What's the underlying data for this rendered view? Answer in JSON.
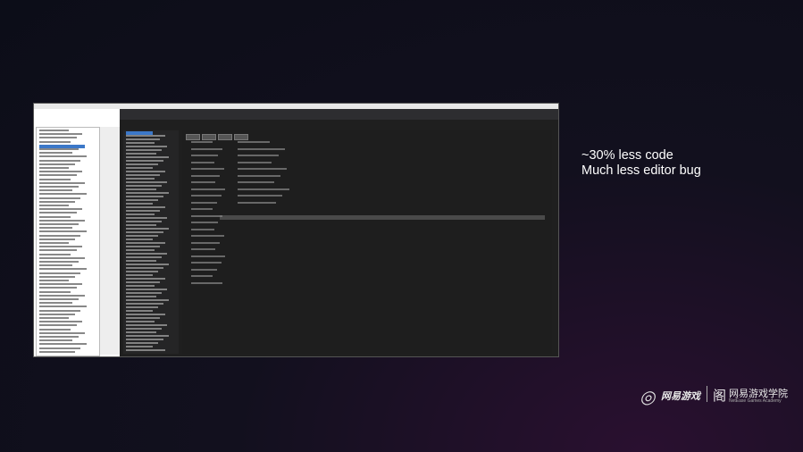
{
  "slide": {
    "line1": "~30% less code",
    "line2": "Much less editor bug"
  },
  "logo": {
    "netease_games": "网易游戏",
    "academy_cn": "网易游戏学院",
    "academy_en": "NetEase Games Academy"
  },
  "colors": {
    "selection": "#3c78c8",
    "dark_bg": "#1e1e1e",
    "accent_bar": "#4a4a4a"
  }
}
